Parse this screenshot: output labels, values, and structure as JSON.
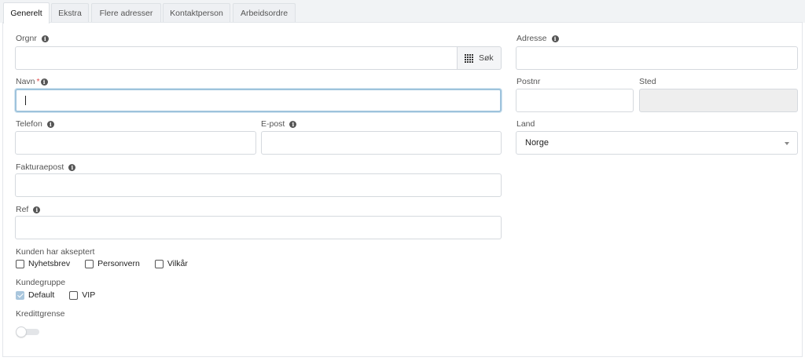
{
  "tabs": [
    {
      "label": "Generelt"
    },
    {
      "label": "Ekstra"
    },
    {
      "label": "Flere adresser"
    },
    {
      "label": "Kontaktperson"
    },
    {
      "label": "Arbeidsordre"
    }
  ],
  "form": {
    "orgnr": {
      "label": "Orgnr",
      "value": "",
      "search_label": "Søk"
    },
    "navn": {
      "label": "Navn",
      "required_marker": "*",
      "value": ""
    },
    "telefon": {
      "label": "Telefon",
      "value": ""
    },
    "epost": {
      "label": "E-post",
      "value": ""
    },
    "fakturaepost": {
      "label": "Fakturaepost",
      "value": ""
    },
    "ref": {
      "label": "Ref",
      "value": ""
    },
    "adresse": {
      "label": "Adresse",
      "value": ""
    },
    "postnr": {
      "label": "Postnr",
      "value": ""
    },
    "sted": {
      "label": "Sted",
      "value": ""
    },
    "land": {
      "label": "Land",
      "value": "Norge"
    },
    "accepted": {
      "label": "Kunden har akseptert",
      "options": [
        {
          "label": "Nyhetsbrev",
          "checked": false
        },
        {
          "label": "Personvern",
          "checked": false
        },
        {
          "label": "Vilkår",
          "checked": false
        }
      ]
    },
    "customer_group": {
      "label": "Kundegruppe",
      "options": [
        {
          "label": "Default",
          "checked": true
        },
        {
          "label": "VIP",
          "checked": false
        }
      ]
    },
    "credit_limit": {
      "label": "Kredittgrense",
      "enabled": false
    }
  },
  "icons": {
    "info": "info-icon",
    "search": "barcode-grid-icon",
    "dropdown": "chevron-down-icon"
  },
  "colors": {
    "focus_border": "#9ec3dc",
    "checked": "#a9c6dd",
    "required": "#e04a4a"
  }
}
